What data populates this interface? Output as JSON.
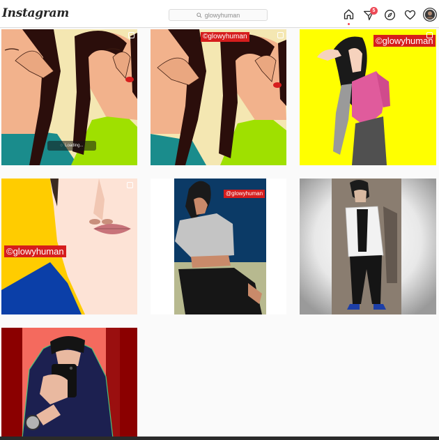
{
  "header": {
    "logo": "Instagram",
    "search_value": "glowyhuman",
    "badge_count": "5",
    "icons": [
      "home-icon",
      "direct-message-icon",
      "explore-compass-icon",
      "activity-heart-icon",
      "profile-avatar"
    ]
  },
  "grid": {
    "posts": [
      {
        "label": "post-1",
        "loading": "Loading...",
        "multi": true
      },
      {
        "label": "post-2",
        "watermark": "©glowyhuman",
        "multi": true
      },
      {
        "label": "post-3",
        "watermark": "©glowyhuman",
        "multi": true
      },
      {
        "label": "post-4",
        "watermark": "©glowyhuman",
        "multi": true
      },
      {
        "label": "post-5",
        "watermark": "@glowyhuman",
        "multi": true
      },
      {
        "label": "post-6"
      },
      {
        "label": "post-7"
      }
    ]
  },
  "colors": {
    "accent_red": "#ed4956",
    "watermark_red": "#d61d1d",
    "bg": "#fafafa"
  }
}
